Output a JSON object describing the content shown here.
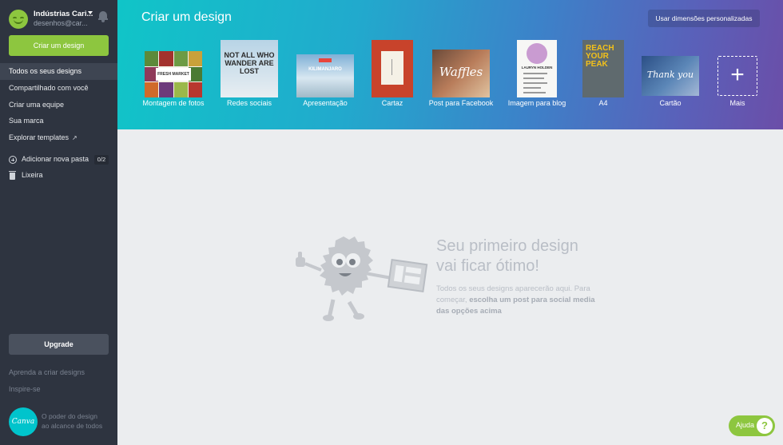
{
  "account": {
    "name": "Indústrias Cari...",
    "email": "desenhos@car..."
  },
  "sidebar": {
    "create_button": "Criar um design",
    "nav": [
      {
        "label": "Todos os seus designs"
      },
      {
        "label": "Compartilhado com você"
      },
      {
        "label": "Criar uma equipe"
      },
      {
        "label": "Sua marca"
      },
      {
        "label": "Explorar templates"
      }
    ],
    "external_link_icon": "↗",
    "add_folder_label": "Adicionar nova pasta",
    "folder_count": "0/2",
    "trash_label": "Lixeira",
    "upgrade_button": "Upgrade",
    "learn_link": "Aprenda a criar designs",
    "inspire_link": "Inspire-se",
    "logo_text": "Canva",
    "tagline_1": "O poder do design",
    "tagline_2": "ao alcance de todos"
  },
  "header": {
    "title": "Criar um design",
    "custom_button": "Usar dimensões personalizadas",
    "tiles": [
      {
        "label": "Montagem de fotos",
        "thumb_text": "FRESH MARKET"
      },
      {
        "label": "Redes sociais",
        "thumb_text": "NOT ALL WHO WANDER ARE LOST"
      },
      {
        "label": "Apresentação",
        "thumb_text": "KILIMANJARO"
      },
      {
        "label": "Cartaz",
        "thumb_text": ""
      },
      {
        "label": "Post para Facebook",
        "thumb_text": "Waffles"
      },
      {
        "label": "Imagem para blog",
        "thumb_text": "LAURYN HOLDEN"
      },
      {
        "label": "A4",
        "thumb_text": "REACH YOUR PEAK"
      },
      {
        "label": "Cartão",
        "thumb_text": "Thank you"
      },
      {
        "label": "Mais",
        "thumb_text": "+"
      }
    ]
  },
  "empty_state": {
    "title_line1": "Seu primeiro design",
    "title_line2": "vai ficar ótimo!",
    "text_plain": "Todos os seus designs aparecerão aqui. Para começar,",
    "text_bold": "escolha um post para social media das opções acima"
  },
  "help": {
    "label": "Ajuda",
    "icon": "?"
  },
  "colors": {
    "sidebar_bg": "#2e3440",
    "accent_green": "#8dc63f",
    "header_gradient_start": "#10c5c8",
    "header_gradient_end": "#6b4ea8",
    "canvas_bg": "#ebedef"
  }
}
